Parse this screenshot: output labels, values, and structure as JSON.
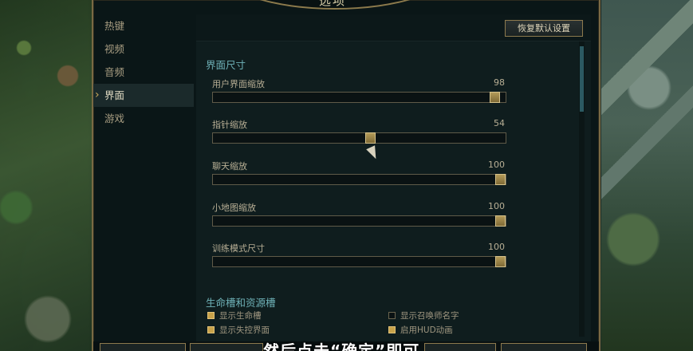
{
  "window": {
    "title": "选项"
  },
  "nav": {
    "items": [
      {
        "label": "热键"
      },
      {
        "label": "视频"
      },
      {
        "label": "音频"
      },
      {
        "label": "界面",
        "active": true
      },
      {
        "label": "游戏"
      }
    ]
  },
  "toolbar": {
    "reset_label": "恢复默认设置"
  },
  "interface": {
    "section_title": "界面尺寸",
    "sliders": [
      {
        "label": "用户界面缩放",
        "value": "98",
        "fraction": 0.98
      },
      {
        "label": "指针缩放",
        "value": "54",
        "fraction": 0.54
      },
      {
        "label": "聊天缩放",
        "value": "100",
        "fraction": 1.0
      },
      {
        "label": "小地图缩放",
        "value": "100",
        "fraction": 1.0
      },
      {
        "label": "训练模式尺寸",
        "value": "100",
        "fraction": 1.0
      }
    ]
  },
  "health": {
    "section_title": "生命槽和资源槽",
    "options": [
      {
        "label": "显示生命槽",
        "checked": true
      },
      {
        "label": "显示召唤师名字",
        "checked": false
      },
      {
        "label": "显示失控界面",
        "checked": true
      },
      {
        "label": "启用HUD动画",
        "checked": true
      }
    ]
  },
  "subtitle": {
    "text": "然后点击“确定”即可"
  },
  "colors": {
    "accent": "#c8a24a",
    "section": "#6fb2b8",
    "panel": "#0f1d1e"
  }
}
